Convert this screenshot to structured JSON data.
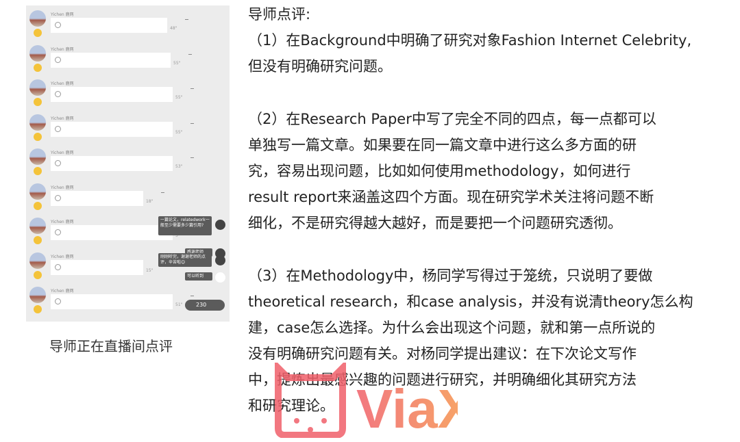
{
  "chat": {
    "sender": "Yichen 鹿两",
    "durations": [
      "48\"",
      "55\"",
      "55\"",
      "55\"",
      "53\"",
      "18\"",
      "5\"",
      "15\"",
      "51\""
    ],
    "comments": [
      "一篇论文，relatedwork一般至少需要多少篇引用?",
      "感谢老师",
      "刚刚听完，谢谢老师的点评，辛苦啦😊",
      "可以听到"
    ],
    "viewer_count": "230"
  },
  "caption": "导师正在直播间点评",
  "review": {
    "heading": "导师点评:",
    "lines1": [
      "（1）在Background中明确了研究对象Fashion Internet Celebrity,",
      "但没有明确研究问题。"
    ],
    "lines2": [
      "（2）在Research Paper中写了完全不同的四点，每一点都可以",
      "单独写一篇文章。如果要在同一篇文章中进行这么多方面的研",
      "究，容易出现问题，比如如何使用methodology，如何进行",
      "result report来涵盖这四个方面。现在研究学术关注将问题不断",
      "细化，不是研究得越大越好，而是要把一个问题研究透彻。"
    ],
    "lines3": [
      "（3）在Methodology中，杨同学写得过于笼统，只说明了要做",
      "theoretical research，和case analysis，并没有说清theory怎么构",
      "建，case怎么选择。为什么会出现这个问题，就和第一点所说的",
      "没有明确研究问题有关。对杨同学提出建议：在下次论文写作",
      "中，提炼出最感兴趣的问题进行研究，并明确细化其研究方法",
      "和研究理论。"
    ]
  },
  "watermark": "ViaX",
  "colors": {
    "watermark": "#f0606a",
    "watermark_end": "#f79a4a"
  }
}
